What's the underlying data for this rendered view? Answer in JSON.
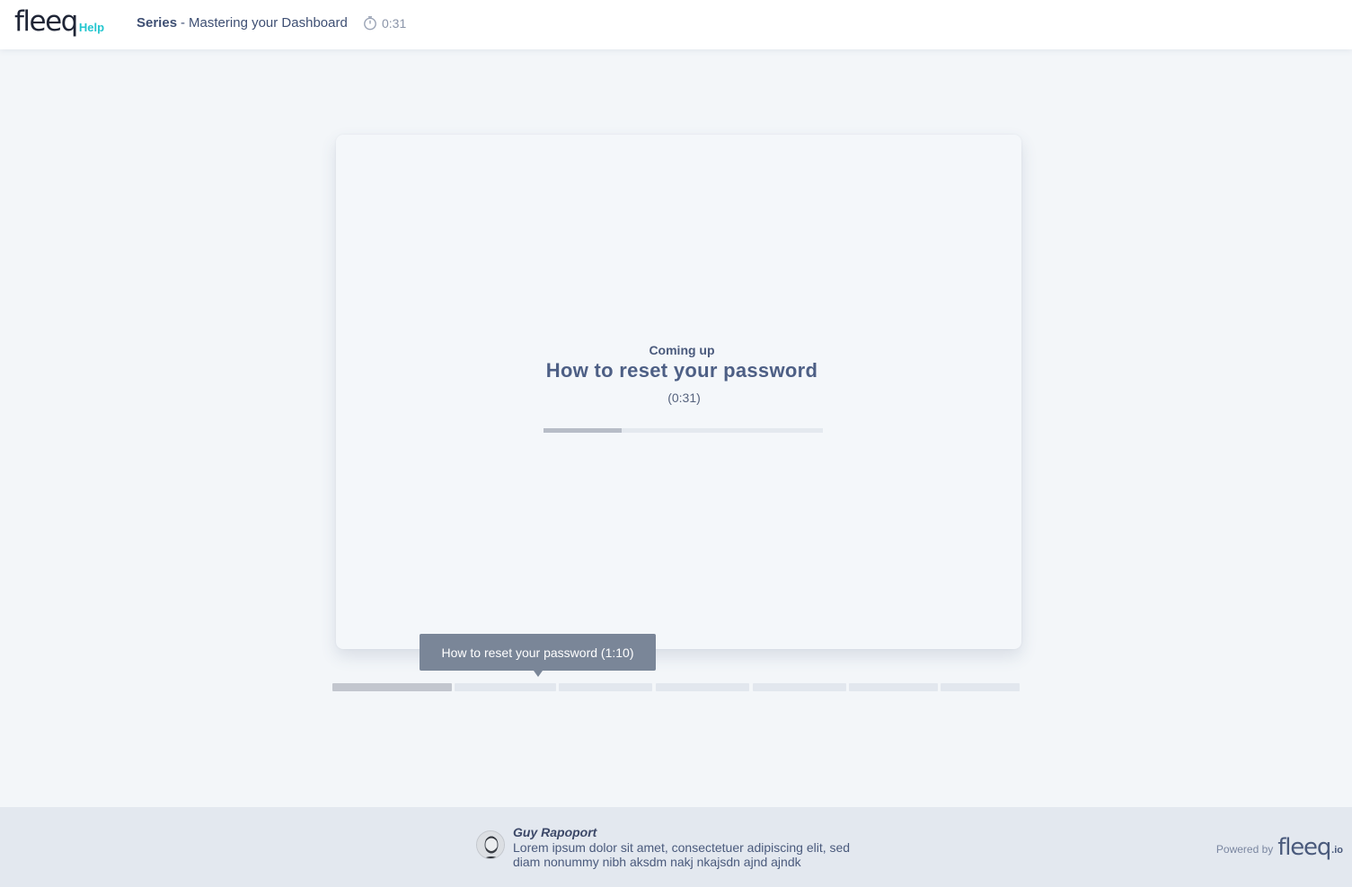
{
  "header": {
    "logo_word": "fleeq",
    "logo_help": "Help",
    "series_label": "Series",
    "series_separator": "-",
    "series_title": "Mastering your Dashboard",
    "duration": "0:31",
    "duration_icon": "stopwatch-icon"
  },
  "player": {
    "coming_up_label": "Coming up",
    "coming_up_title": "How to reset your password",
    "coming_up_duration": "(0:31)",
    "countdown_progress": 0.28
  },
  "tooltip": {
    "text": "How to reset your password (1:10)"
  },
  "chapters": [
    {
      "played": true
    },
    {
      "played": false
    },
    {
      "played": false
    },
    {
      "played": false
    },
    {
      "played": false
    },
    {
      "played": false
    },
    {
      "played": false
    }
  ],
  "footer": {
    "author_name": "Guy Rapoport",
    "author_bio": "Lorem ipsum dolor sit amet, consectetuer adipiscing elit, sed diam nonummy nibh aksdm nakj nkajsdn  ajnd ajndk",
    "powered_by": "Powered by",
    "powered_logo": "fleeq",
    "powered_suffix": ".io"
  },
  "colors": {
    "accent": "#23c6cf",
    "background": "#f3f6f9",
    "footer_bg": "#e3e8ef",
    "tooltip_bg": "#7a8698",
    "text_primary": "#4a5a7c"
  }
}
